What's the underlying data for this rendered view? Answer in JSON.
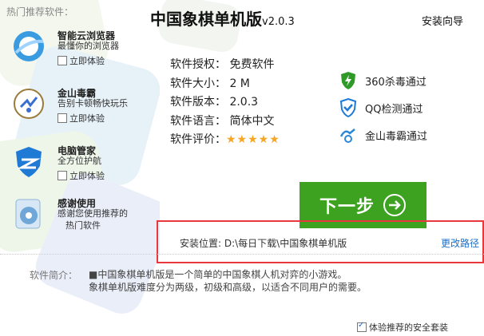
{
  "sidebar": {
    "title": "热门推荐软件：",
    "apps": [
      {
        "name": "智能云浏览器",
        "desc": "最懂你的浏览器",
        "cb": "立即体验"
      },
      {
        "name": "金山毒霸",
        "desc": "告别卡顿畅快玩乐",
        "cb": "立即体验"
      },
      {
        "name": "电脑管家",
        "desc": "全方位护航",
        "cb": "立即体验"
      },
      {
        "name": "感谢使用",
        "desc": "感谢您使用推荐的",
        "desc2": "热门软件"
      }
    ]
  },
  "header": {
    "title": "中国象棋单机版",
    "version": "v2.0.3",
    "wizard": "安装向导"
  },
  "info": {
    "license": "软件授权： 免费软件",
    "size": "软件大小： 2 M",
    "version": "软件版本： 2.0.3",
    "language": "软件语言： 简体中文",
    "rating_label": "软件评价：",
    "rating_stars": "★★★★★"
  },
  "badges": [
    {
      "label": "360杀毒通过",
      "icon": "360-shield-icon"
    },
    {
      "label": "QQ检测通过",
      "icon": "qq-shield-icon"
    },
    {
      "label": "金山毒霸通过",
      "icon": "duba-icon"
    }
  ],
  "next_button": "下一步",
  "install": {
    "label": "安装位置: D:\\每日下载\\中国象棋单机版",
    "change": "更改路径"
  },
  "intro": {
    "label": "软件简介：",
    "line1": "■中国象棋单机版是一个简单的中国象棋人机对弈的小游戏。",
    "line2": "象棋单机版难度分为两级，初级和高级，以适合不同用户的需要。"
  },
  "safe_pack": "体验推荐的安全套装",
  "colors": {
    "accent_green": "#3ca21f",
    "highlight_red": "#e8383d",
    "link_blue": "#1a6fc9",
    "star_gold": "#f5a623"
  }
}
